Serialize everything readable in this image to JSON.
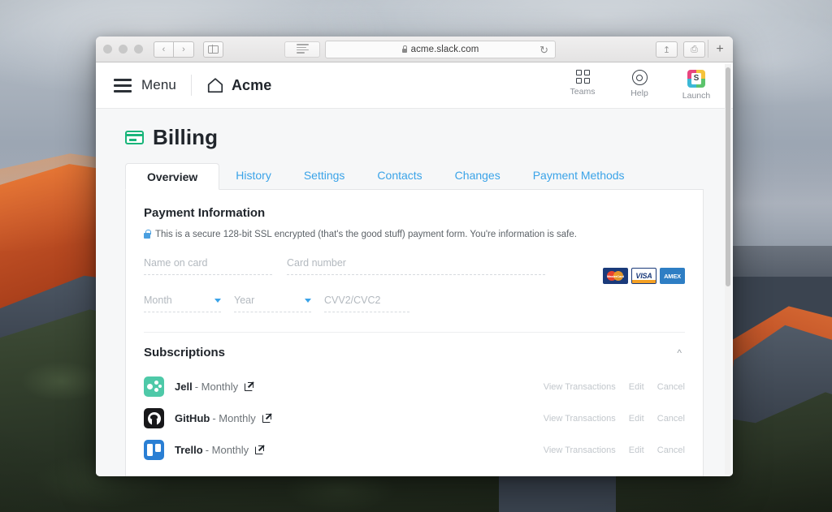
{
  "browser": {
    "url": "acme.slack.com",
    "lock_icon": "lock-icon",
    "reload_icon": "reload-icon",
    "back_icon": "chevron-left-icon",
    "forward_icon": "chevron-right-icon",
    "sidebar_icon": "sidebar-toggle-icon",
    "reader_icon": "reader-view-icon",
    "share_icon": "share-icon",
    "tabs_icon": "show-tabs-icon",
    "new_tab_icon": "plus-icon"
  },
  "app_header": {
    "menu_label": "Menu",
    "menu_icon": "hamburger-icon",
    "home_icon": "home-icon",
    "org_name": "Acme",
    "right_items": [
      {
        "label": "Teams",
        "icon": "teams-grid-icon"
      },
      {
        "label": "Help",
        "icon": "help-circle-icon"
      },
      {
        "label": "Launch",
        "icon": "slack-logo-icon"
      }
    ]
  },
  "page": {
    "title": "Billing",
    "title_icon": "credit-card-icon",
    "tabs": [
      {
        "label": "Overview",
        "active": true
      },
      {
        "label": "History",
        "active": false
      },
      {
        "label": "Settings",
        "active": false
      },
      {
        "label": "Contacts",
        "active": false
      },
      {
        "label": "Changes",
        "active": false
      },
      {
        "label": "Payment Methods",
        "active": false
      }
    ]
  },
  "payment": {
    "section_title": "Payment Information",
    "secure_note": "This is a secure 128-bit SSL encrypted (that's the good stuff) payment form. You're information is safe.",
    "secure_icon": "lock-icon",
    "fields": {
      "name_on_card": {
        "placeholder": "Name on card",
        "value": ""
      },
      "card_number": {
        "placeholder": "Card number",
        "value": ""
      },
      "month": {
        "placeholder": "Month",
        "value": ""
      },
      "year": {
        "placeholder": "Year",
        "value": ""
      },
      "cvv": {
        "placeholder": "CVV2/CVC2",
        "value": ""
      }
    },
    "accepted_cards": [
      {
        "name": "mastercard",
        "label": "MasterCard"
      },
      {
        "name": "visa",
        "label": "VISA"
      },
      {
        "name": "amex",
        "label": "AMEX"
      }
    ]
  },
  "subscriptions": {
    "title": "Subscriptions",
    "collapse_icon": "chevron-up-icon",
    "actions": {
      "view_transactions": "View Transactions",
      "edit": "Edit",
      "cancel": "Cancel"
    },
    "items": [
      {
        "name": "Jell",
        "period": "- Monthly",
        "icon": "jell-logo-icon",
        "link_icon": "external-link-icon"
      },
      {
        "name": "GitHub",
        "period": "- Monthly",
        "icon": "github-logo-icon",
        "link_icon": "external-link-icon"
      },
      {
        "name": "Trello",
        "period": "- Monthly",
        "icon": "trello-logo-icon",
        "link_icon": "external-link-icon"
      }
    ]
  },
  "colors": {
    "link_blue": "#3aa3e8",
    "brand_green": "#19b57a",
    "text_dark": "#21262c",
    "muted": "#c2c7cc"
  }
}
